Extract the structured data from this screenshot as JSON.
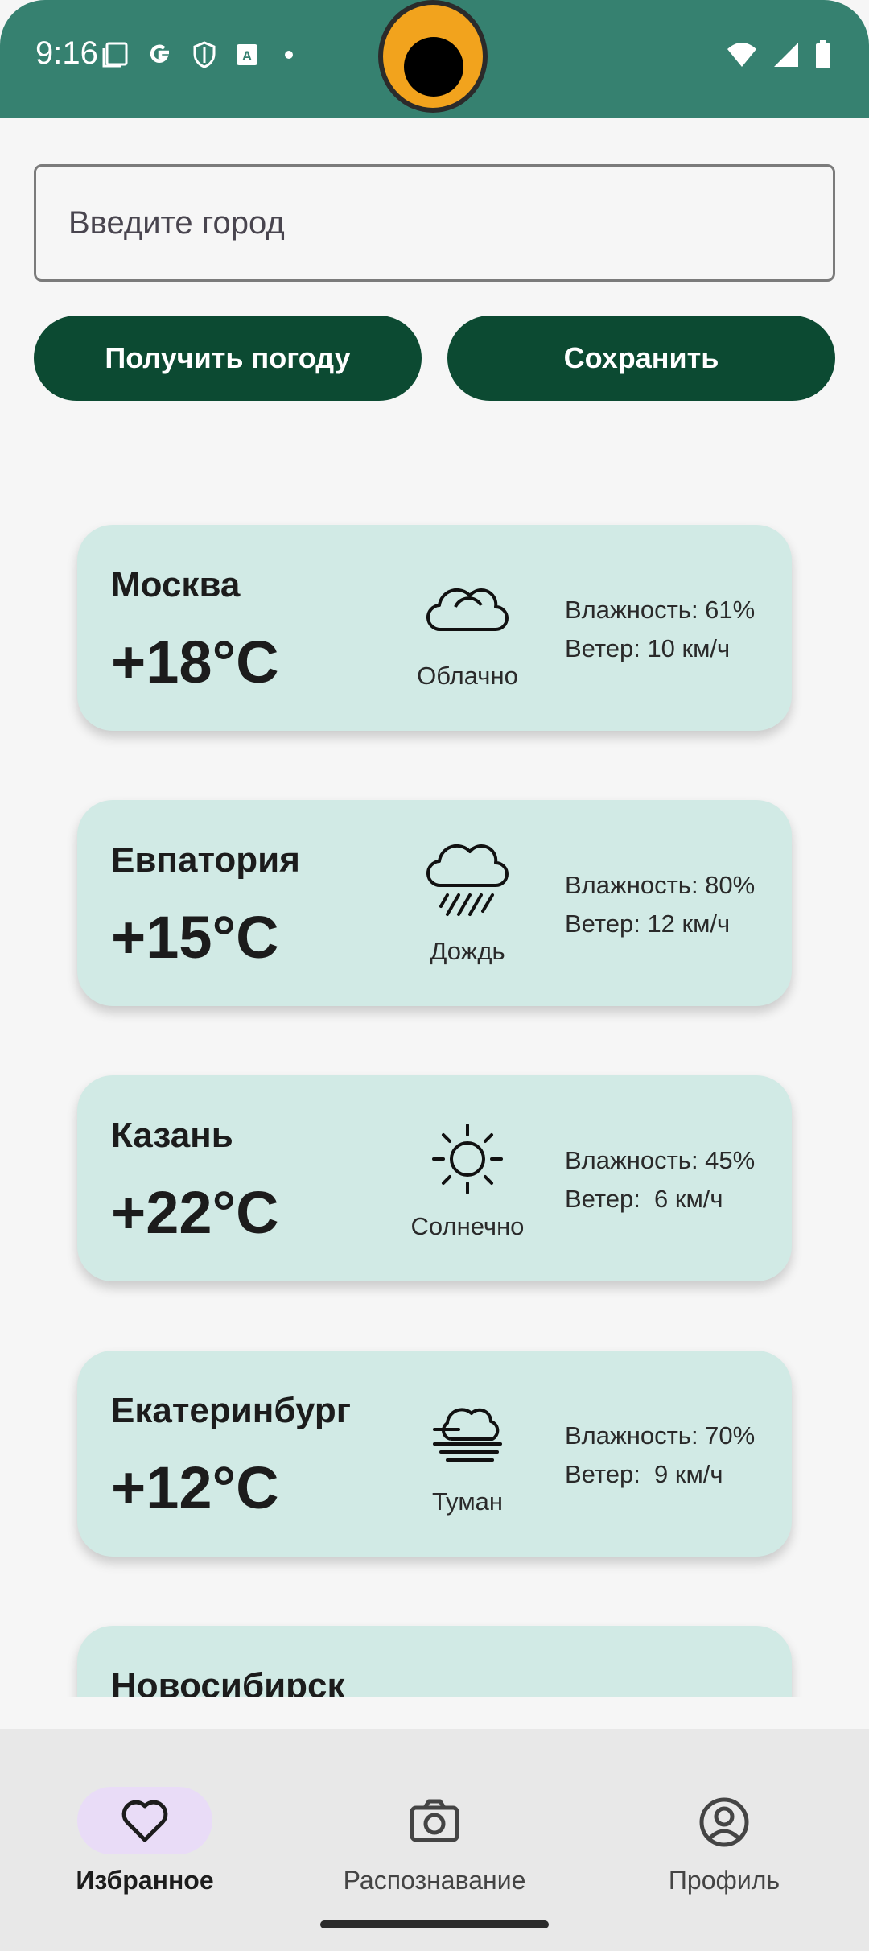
{
  "status_bar": {
    "time": "9:16",
    "left_icons": [
      "screenshot-icon",
      "google-icon",
      "shield-icon",
      "accessibility-icon",
      "dot-icon"
    ],
    "right_icons": [
      "wifi-icon",
      "signal-icon",
      "battery-icon"
    ]
  },
  "search": {
    "placeholder": "Введите город"
  },
  "actions": {
    "get_weather_label": "Получить погоду",
    "save_label": "Сохранить"
  },
  "cards": [
    {
      "city": "Москва",
      "temp": "+18°C",
      "condition": "Облачно",
      "icon": "cloud-icon",
      "humidity": "Влажность: 61%",
      "wind": "Ветер: 10 км/ч"
    },
    {
      "city": "Евпатория",
      "temp": "+15°C",
      "condition": "Дождь",
      "icon": "rain-icon",
      "humidity": "Влажность: 80%",
      "wind": "Ветер: 12 км/ч"
    },
    {
      "city": "Казань",
      "temp": "+22°C",
      "condition": "Солнечно",
      "icon": "sun-icon",
      "humidity": "Влажность: 45%",
      "wind": "Ветер:  6 км/ч"
    },
    {
      "city": "Екатеринбург",
      "temp": "+12°C",
      "condition": "Туман",
      "icon": "fog-icon",
      "humidity": "Влажность: 70%",
      "wind": "Ветер:  9 км/ч"
    },
    {
      "city": "Новосибирск",
      "icon": "wind-icon"
    }
  ],
  "bottom_nav": [
    {
      "label": "Избранное",
      "icon": "heart-icon",
      "active": true
    },
    {
      "label": "Распознавание",
      "icon": "camera-icon",
      "active": false
    },
    {
      "label": "Профиль",
      "icon": "profile-icon",
      "active": false
    }
  ],
  "colors": {
    "status_bar": "#368170",
    "button": "#0c4a32",
    "card": "#d1eae5",
    "nav_active_pill": "#e9dcf7"
  }
}
